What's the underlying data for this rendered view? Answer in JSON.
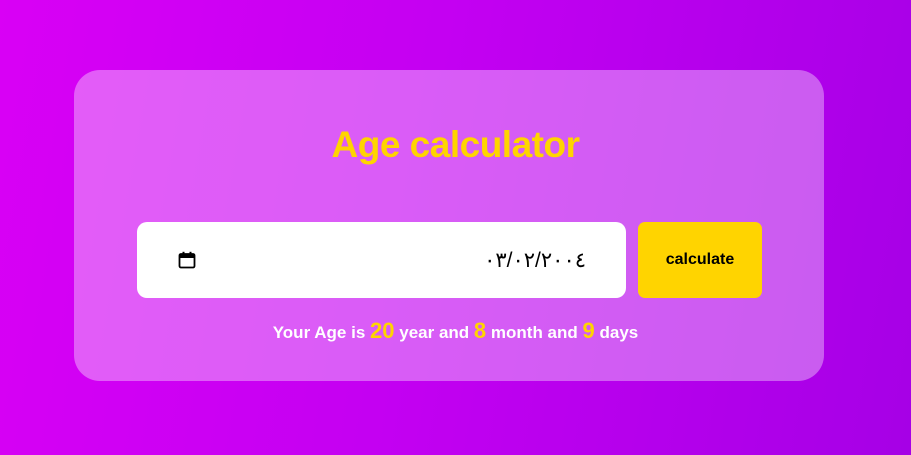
{
  "title": "Age calculator",
  "date_input": {
    "value": "٠٣/٠٢/٢٠٠٤",
    "icon": "calendar-icon"
  },
  "calculate_button": {
    "label": "calculate"
  },
  "result": {
    "prefix": "Your Age is",
    "years": "20",
    "years_label": "year and",
    "months": "8",
    "months_label": "month and",
    "days": "9",
    "days_label": "days"
  },
  "colors": {
    "accent": "#ffd400",
    "background_start": "#d900f5",
    "background_end": "#a600e6",
    "text": "#ffffff"
  }
}
